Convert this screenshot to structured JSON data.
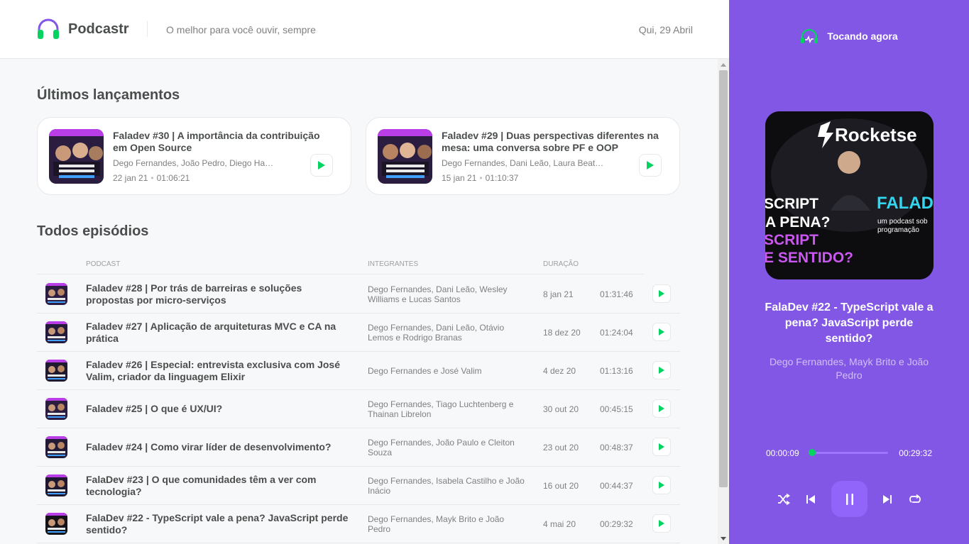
{
  "header": {
    "brand": "Podcastr",
    "tagline": "O melhor para você ouvir, sempre",
    "date": "Qui, 29 Abril"
  },
  "latest": {
    "title": "Últimos lançamentos",
    "items": [
      {
        "title": "Faladev #30 | A importância da contribuição em Open Source",
        "members": "Dego Fernandes, João Pedro, Diego Haz…",
        "date": "22 jan 21",
        "duration": "01:06:21"
      },
      {
        "title": "Faladev #29 | Duas perspectivas diferentes na mesa: uma conversa sobre PF e OOP",
        "members": "Dego Fernandes, Dani Leão, Laura Beatr…",
        "date": "15 jan 21",
        "duration": "01:10:37"
      }
    ]
  },
  "all": {
    "title": "Todos episódios",
    "columns": {
      "podcast": "PODCAST",
      "members": "INTEGRANTES",
      "duration": "DURAÇÃO"
    },
    "rows": [
      {
        "title": "Faladev #28 | Por trás de barreiras e soluções propostas por micro-serviços",
        "members": "Dego Fernandes, Dani Leão, Wesley Williams e Lucas Santos",
        "date": "8 jan 21",
        "duration": "01:31:46"
      },
      {
        "title": "Faladev #27 | Aplicação de arquiteturas MVC e CA na prática",
        "members": "Dego Fernandes, Dani Leão, Otávio Lemos e Rodrigo Branas",
        "date": "18 dez 20",
        "duration": "01:24:04"
      },
      {
        "title": "Faladev #26 | Especial: entrevista exclusiva com José Valim, criador da linguagem Elixir",
        "members": "Dego Fernandes e José Valim",
        "date": "4 dez 20",
        "duration": "01:13:16"
      },
      {
        "title": "Faladev #25 | O que é UX/UI?",
        "members": "Dego Fernandes, Tiago Luchtenberg e Thainan Librelon",
        "date": "30 out 20",
        "duration": "00:45:15"
      },
      {
        "title": "Faladev #24 | Como virar líder de desenvolvimento?",
        "members": "Dego Fernandes, João Paulo e Cleiton Souza",
        "date": "23 out 20",
        "duration": "00:48:37"
      },
      {
        "title": "FalaDev #23 | O que comunidades têm a ver com tecnologia?",
        "members": "Dego Fernandes, Isabela Castilho e João Inácio",
        "date": "16 out 20",
        "duration": "00:44:37"
      },
      {
        "title": "FalaDev #22 - TypeScript vale a pena? JavaScript perde sentido?",
        "members": "Dego Fernandes, Mayk Brito e João Pedro",
        "date": "4 mai 20",
        "duration": "00:29:32"
      }
    ]
  },
  "player": {
    "label": "Tocando agora",
    "cover": {
      "brand": "Rocketse",
      "line1": "SCRIPT",
      "line2": "A PENA?",
      "line3": "SCRIPT",
      "line4": "E SENTIDO?",
      "show": "FALAD",
      "sub1": "um podcast sob",
      "sub2": "programação"
    },
    "title": "FalaDev #22 - TypeScript vale a pena? JavaScript perde sentido?",
    "members": "Dego Fernandes, Mayk Brito e João Pedro",
    "current_time": "00:00:09",
    "total_time": "00:29:32",
    "progress": 0.005
  },
  "colors": {
    "accent": "#8257e5",
    "green": "#04d361"
  }
}
